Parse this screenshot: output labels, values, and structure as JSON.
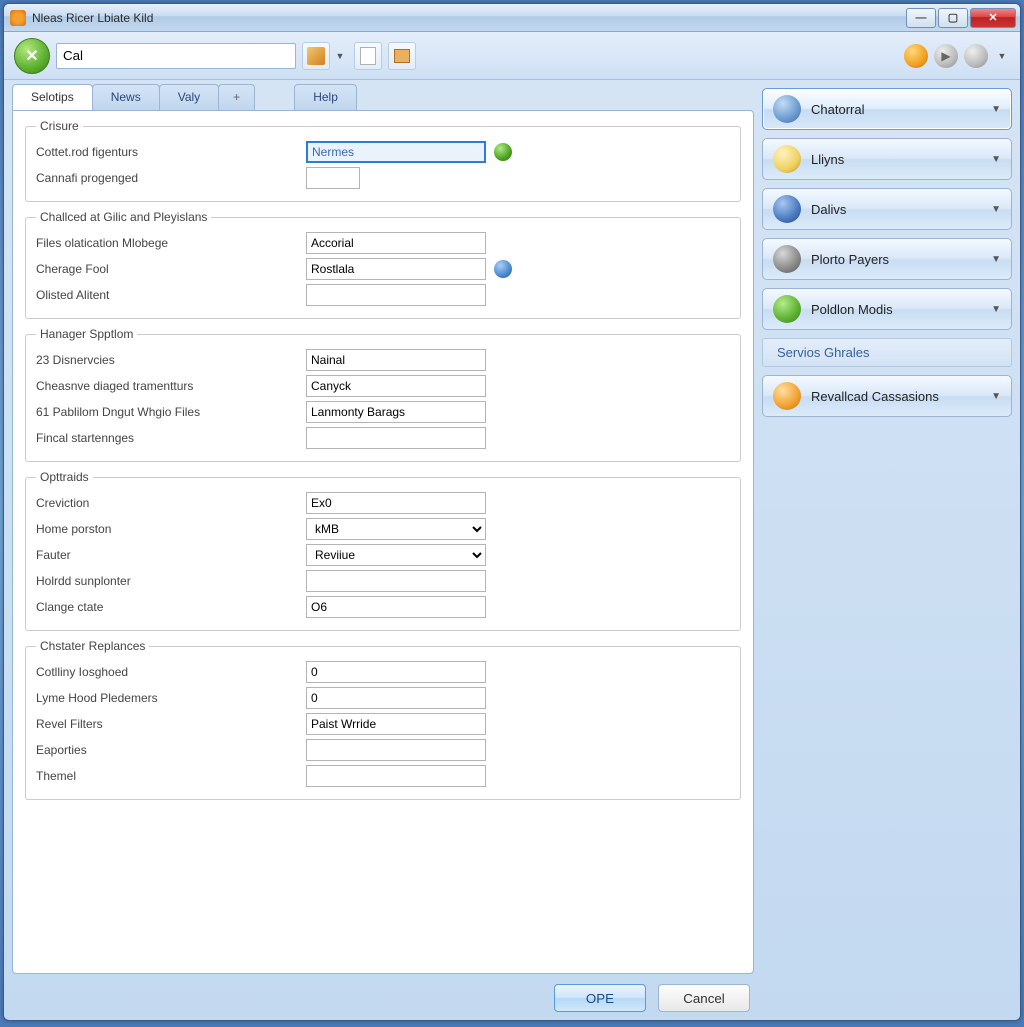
{
  "window": {
    "title": "Nleas Ricer Lbiate Kild"
  },
  "toolbar": {
    "search_value": "Cal"
  },
  "tabs": {
    "selotips": "Selotips",
    "news": "News",
    "valy": "Valy",
    "plus": "+",
    "help": "Help"
  },
  "groups": {
    "crisure": {
      "legend": "Crisure",
      "rows": [
        {
          "label": "Cottet.rod figenturs",
          "value": "Nermes",
          "highlight": true,
          "orb": "green"
        },
        {
          "label": "Cannafi progenged",
          "value": ""
        }
      ]
    },
    "challced": {
      "legend": "Challced at Gilic and Pleyislans",
      "rows": [
        {
          "label": "Files olatication Mlobege",
          "value": "Accorial"
        },
        {
          "label": "Cherage Fool",
          "value": "Rostlala",
          "orb": "blue"
        },
        {
          "label": "Olisted Alitent",
          "value": ""
        }
      ]
    },
    "hanager": {
      "legend": "Hanager Spptlom",
      "rows": [
        {
          "label": "23 Disnervcies",
          "value": "Nainal"
        },
        {
          "label": "Cheasnve diaged tramentturs",
          "value": "Canyck"
        },
        {
          "label": "61 Pablilom Dngut Whgio Files",
          "value": "Lanmonty Barags"
        },
        {
          "label": "Fincal startennges",
          "value": ""
        }
      ]
    },
    "optraids": {
      "legend": "Opttraids",
      "rows": [
        {
          "label": "Creviction",
          "value": "Ex0"
        },
        {
          "label": "Home porston",
          "value": "kMB",
          "type": "select"
        },
        {
          "label": "Fauter",
          "value": "Reviiue",
          "type": "select"
        },
        {
          "label": "Holrdd sunplonter",
          "value": ""
        },
        {
          "label": "Clange ctate",
          "value": "O6"
        }
      ]
    },
    "chstater": {
      "legend": "Chstater Replances",
      "rows": [
        {
          "label": "Cotlliny Iosghoed",
          "value": "0"
        },
        {
          "label": "Lyme Hood Pledemers",
          "value": "0"
        },
        {
          "label": "Revel Filters",
          "value": "Paist Wrride"
        },
        {
          "label": "Eaporties",
          "value": ""
        },
        {
          "label": "Themel",
          "value": ""
        }
      ]
    }
  },
  "buttons": {
    "ope": "OPE",
    "cancel": "Cancel"
  },
  "sidebar": {
    "items": [
      {
        "label": "Chatorral",
        "iconColor": "radial-gradient(circle at 35% 30%, #c4ddf4, #6a9ad0 60%, #3a6aa0)"
      },
      {
        "label": "Lliyns",
        "iconColor": "radial-gradient(circle at 35% 30%, #fff4c0, #f0d060 60%, #c09020)"
      },
      {
        "label": "Dalivs",
        "iconColor": "radial-gradient(circle at 35% 30%, #a8c8f0, #4a78c0 60%, #2a4880)"
      },
      {
        "label": "Plorto Payers",
        "iconColor": "radial-gradient(circle at 35% 30%, #d8d8d8, #888 60%, #555)"
      },
      {
        "label": "Poldlon Modis",
        "iconColor": "radial-gradient(circle at 35% 30%, #b4ec8a, #5cb030 60%, #3c8018)"
      }
    ],
    "service": "Servios Ghrales",
    "last": {
      "label": "Revallcad Cassasions",
      "iconColor": "radial-gradient(circle at 35% 30%, #ffe0a0, #f0a030 60%, #c07010)"
    }
  }
}
